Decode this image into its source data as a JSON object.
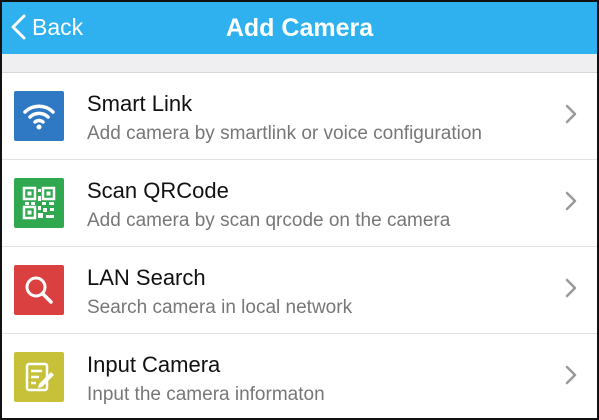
{
  "header": {
    "back_label": "Back",
    "title": "Add Camera",
    "background": "#2fb1f0"
  },
  "items": [
    {
      "title": "Smart Link",
      "subtitle": "Add camera by smartlink or voice configuration",
      "icon": "wifi-icon",
      "icon_color": "#2f78c4"
    },
    {
      "title": "Scan QRCode",
      "subtitle": "Add camera by scan qrcode on the camera",
      "icon": "qrcode-icon",
      "icon_color": "#2fa84f"
    },
    {
      "title": "LAN Search",
      "subtitle": "Search camera in local network",
      "icon": "search-icon",
      "icon_color": "#d9403f"
    },
    {
      "title": "Input Camera",
      "subtitle": "Input the camera informaton",
      "icon": "edit-note-icon",
      "icon_color": "#c7c13a"
    }
  ]
}
